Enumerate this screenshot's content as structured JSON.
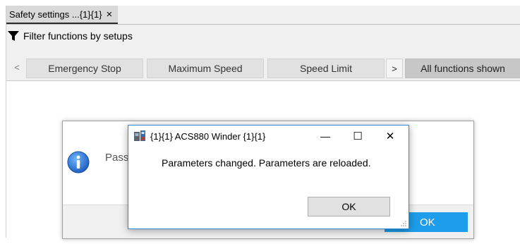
{
  "doc_tab": {
    "title": "Safety settings ...{1}{1}",
    "close_glyph": "×"
  },
  "filter": {
    "icon": "funnel-icon",
    "label": "Filter functions by setups"
  },
  "function_bar": {
    "prev_glyph": "<",
    "next_glyph": ">",
    "buttons": [
      "Emergency Stop",
      "Maximum Speed",
      "Speed Limit"
    ],
    "all_label": "All functions shown"
  },
  "background_dialog": {
    "icon": "info-icon",
    "text": "Pass",
    "ok_label": "OK",
    "ok_color": "#1e9dea"
  },
  "modal": {
    "icon": "acs880-drive-icon",
    "title": "{1}{1} ACS880 Winder {1}{1}",
    "minimize_glyph": "—",
    "maximize_glyph": "☐",
    "close_glyph": "✕",
    "message": "Parameters changed. Parameters are reloaded.",
    "ok_label": "OK",
    "border_color": "#2a8ad4"
  }
}
